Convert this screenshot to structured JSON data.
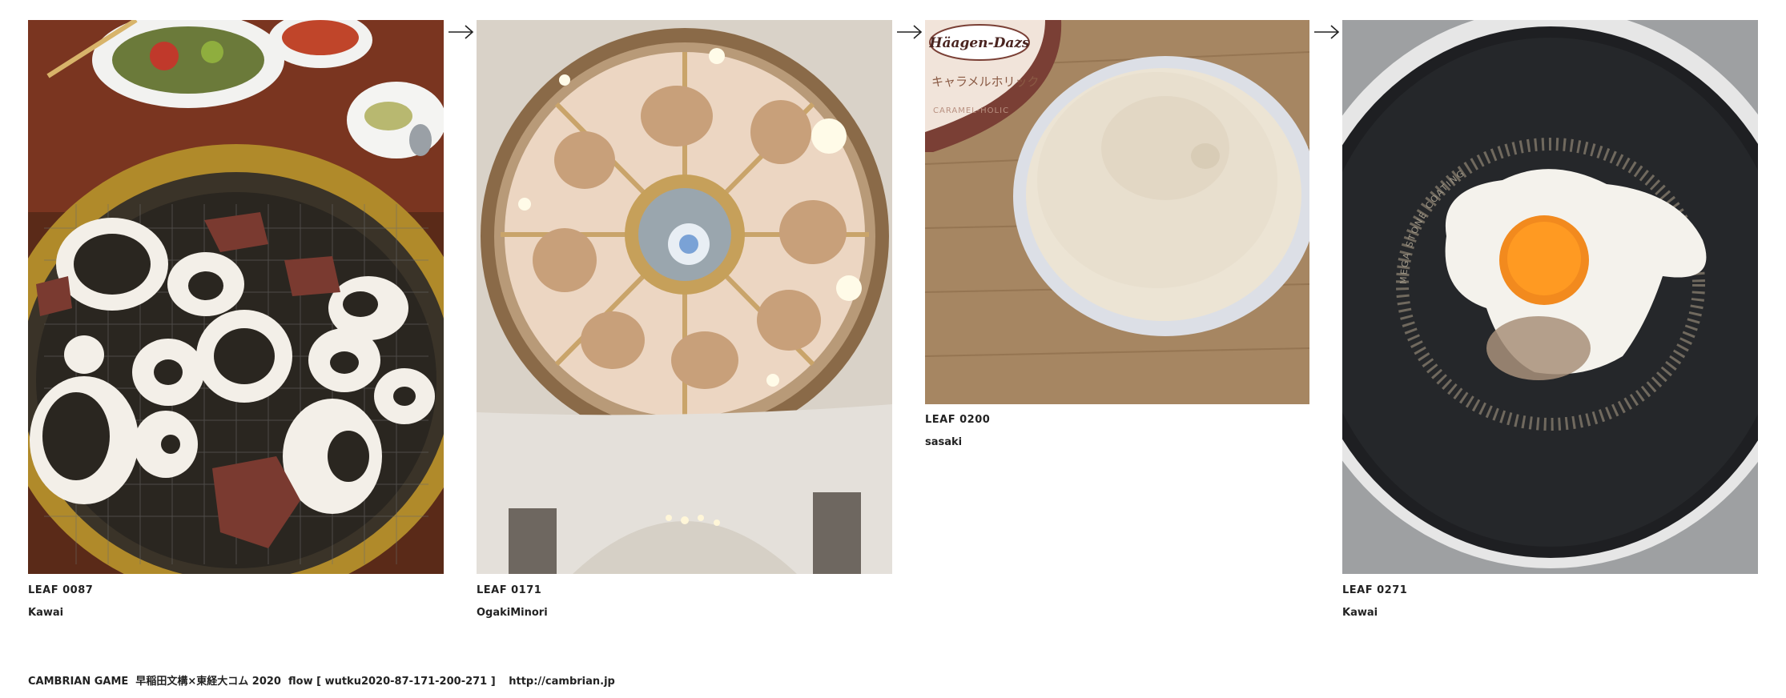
{
  "leaves": [
    {
      "id": "LEAF 0087",
      "author": "Kawai",
      "photo_subject": "yakiniku-grill-photo"
    },
    {
      "id": "LEAF 0171",
      "author": "OgakiMinori",
      "photo_subject": "baroque-dome-ceiling-photo"
    },
    {
      "id": "LEAF 0200",
      "author": "sasaki",
      "photo_subject": "ice-cream-cup-photo"
    },
    {
      "id": "LEAF 0271",
      "author": "Kawai",
      "photo_subject": "fried-egg-pan-photo"
    }
  ],
  "photo_text": {
    "brand": "Häagen-Dazs",
    "flavor_jp": "キャラメルホリック",
    "flavor_en": "CARAMEL-HOLIC",
    "pan_text": "MEGA STONE COATING"
  },
  "footer": {
    "text": "CAMBRIAN GAME  早稲田文構×東経大コム 2020  flow [ wutku2020-87-171-200-271 ]",
    "link": "http://cambrian.jp"
  },
  "colors": {
    "text": "#222222",
    "background": "#ffffff"
  }
}
